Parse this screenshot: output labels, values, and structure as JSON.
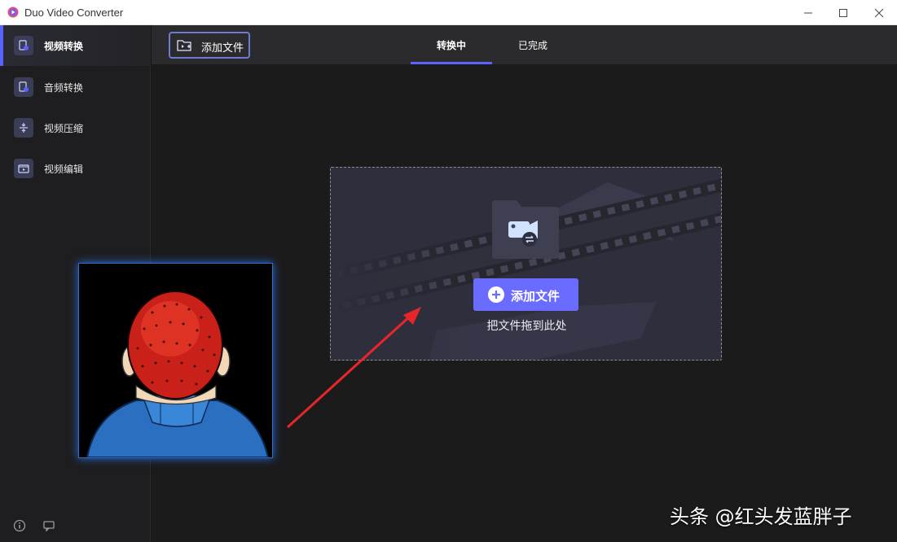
{
  "app": {
    "title": "Duo Video Converter"
  },
  "sidebar": {
    "items": [
      {
        "label": "视频转换",
        "icon": "video-convert-icon",
        "active": true
      },
      {
        "label": "音频转换",
        "icon": "audio-convert-icon",
        "active": false
      },
      {
        "label": "视频压缩",
        "icon": "compress-icon",
        "active": false
      },
      {
        "label": "视频编辑",
        "icon": "video-edit-icon",
        "active": false
      }
    ],
    "bottom_icons": [
      "info-icon",
      "feedback-icon"
    ]
  },
  "toolbar": {
    "add_file_label": "添加文件",
    "tabs": [
      {
        "label": "转换中",
        "active": true
      },
      {
        "label": "已完成",
        "active": false
      }
    ]
  },
  "dropzone": {
    "button_label": "添加文件",
    "hint": "把文件拖到此处"
  },
  "watermark": "头条 @红头发蓝胖子",
  "colors": {
    "accent": "#6a6bff",
    "sidebar_bg": "#1e1e20",
    "toolbar_bg": "#2b2b2d",
    "main_bg": "#1b1b1c",
    "annotation_arrow": "#e8262a"
  }
}
